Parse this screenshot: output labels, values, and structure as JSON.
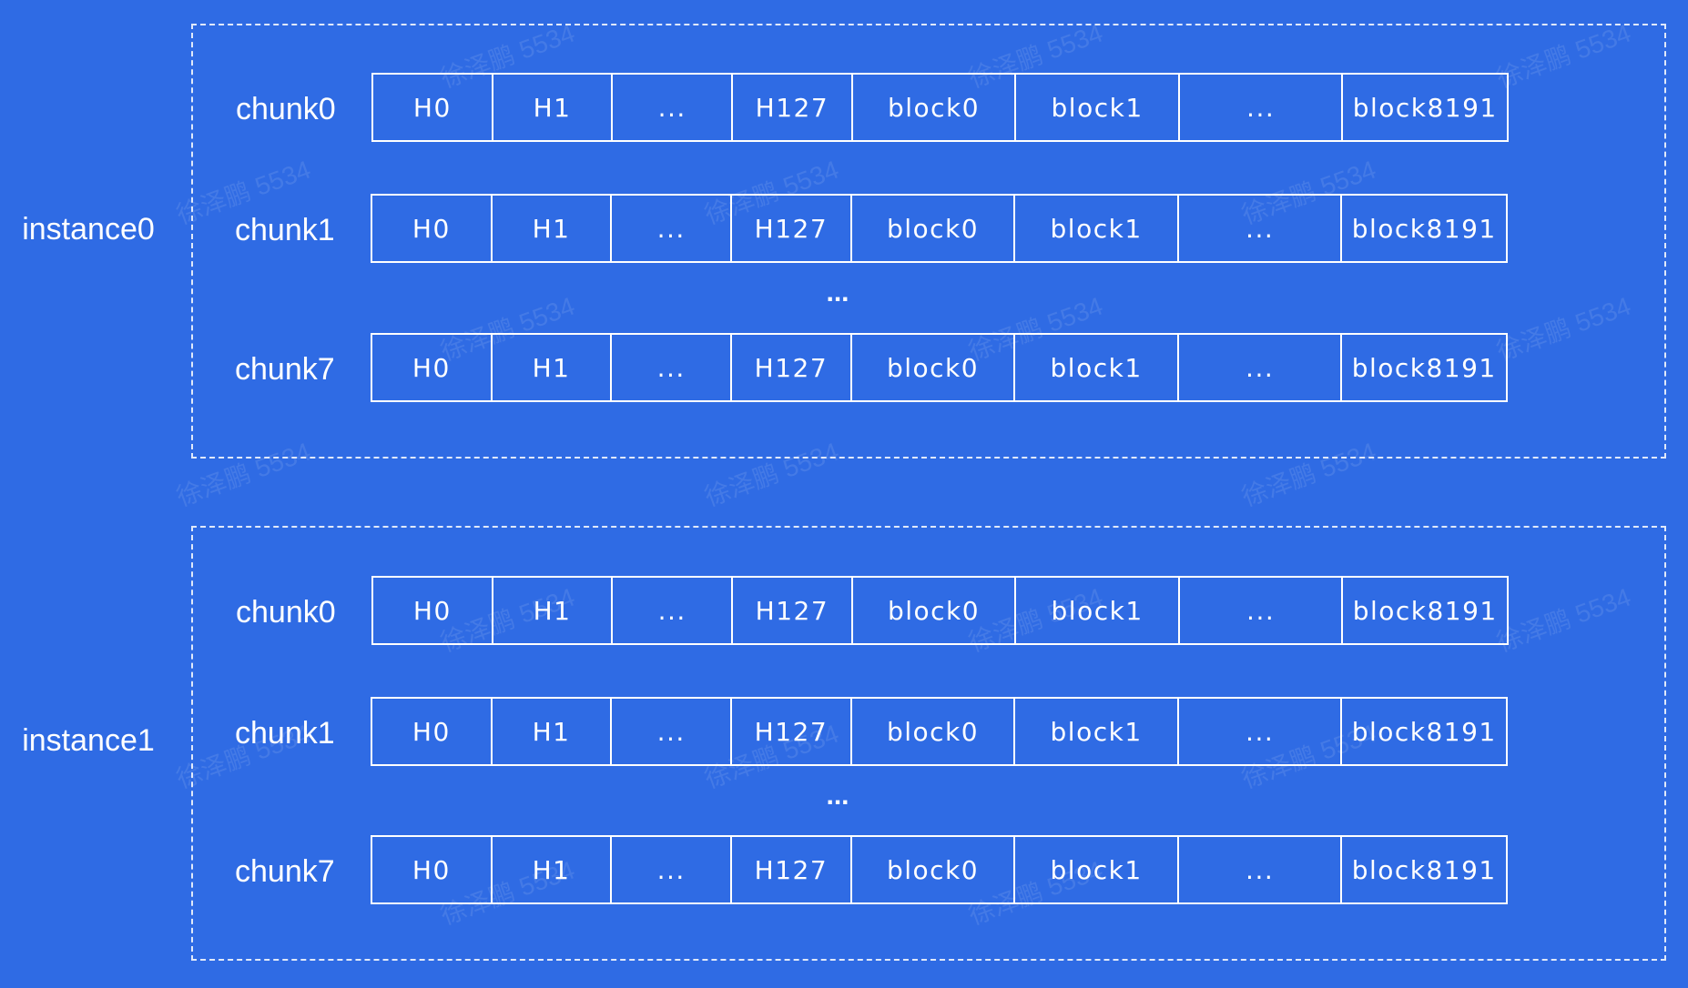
{
  "instances": [
    {
      "label": "instance0",
      "chunks": [
        {
          "label": "chunk0",
          "cells": [
            "H0",
            "H1",
            "...",
            "H127",
            "block0",
            "block1",
            "...",
            "block8191"
          ]
        },
        {
          "label": "chunk1",
          "cells": [
            "H0",
            "H1",
            "...",
            "H127",
            "block0",
            "block1",
            "...",
            "block8191"
          ]
        },
        {
          "label": "chunk7",
          "cells": [
            "H0",
            "H1",
            "...",
            "H127",
            "block0",
            "block1",
            "...",
            "block8191"
          ]
        }
      ],
      "gap_dots": "..."
    },
    {
      "label": "instance1",
      "chunks": [
        {
          "label": "chunk0",
          "cells": [
            "H0",
            "H1",
            "...",
            "H127",
            "block0",
            "block1",
            "...",
            "block8191"
          ]
        },
        {
          "label": "chunk1",
          "cells": [
            "H0",
            "H1",
            "...",
            "H127",
            "block0",
            "block1",
            "...",
            "block8191"
          ]
        },
        {
          "label": "chunk7",
          "cells": [
            "H0",
            "H1",
            "...",
            "H127",
            "block0",
            "block1",
            "...",
            "block8191"
          ]
        }
      ],
      "gap_dots": "..."
    }
  ],
  "watermark_text": "徐泽鹏 5534",
  "colors": {
    "background": "#2f6be4",
    "foreground": "#ffffff"
  }
}
